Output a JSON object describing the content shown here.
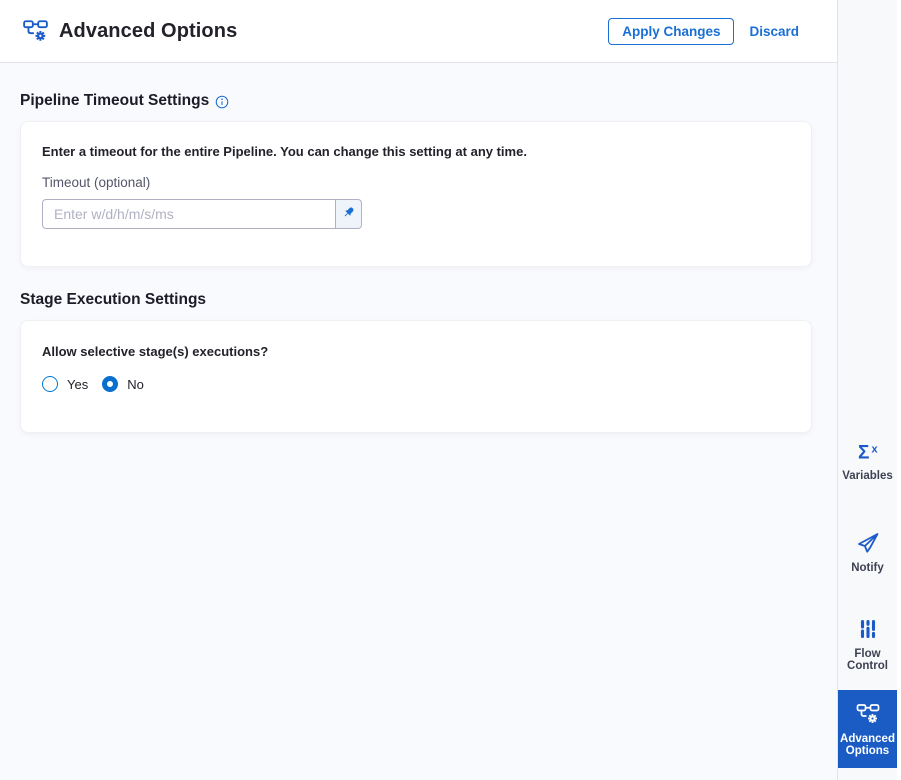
{
  "header": {
    "title": "Advanced Options",
    "apply_label": "Apply Changes",
    "discard_label": "Discard",
    "title_icon": "pipeline-gear-icon"
  },
  "pipeline_timeout": {
    "heading": "Pipeline Timeout Settings",
    "info_icon": "info-icon",
    "description": "Enter a timeout for the entire Pipeline. You can change this setting at any time.",
    "timeout_label": "Timeout (optional)",
    "timeout_placeholder": "Enter w/d/h/m/s/ms",
    "timeout_value": "",
    "pin_icon": "pin-icon"
  },
  "stage_execution": {
    "heading": "Stage Execution Settings",
    "question": "Allow selective stage(s) executions?",
    "options": [
      {
        "label": "Yes",
        "selected": false
      },
      {
        "label": "No",
        "selected": true
      }
    ]
  },
  "sidebar": {
    "items": [
      {
        "label": "Variables",
        "icon": "sigma-x-icon",
        "selected": false
      },
      {
        "label": "Notify",
        "icon": "paper-plane-icon",
        "selected": false
      },
      {
        "label": "Flow Control",
        "icon": "sliders-icon",
        "selected": false
      },
      {
        "label": "Advanced Options",
        "icon": "pipeline-gear-icon",
        "selected": true
      }
    ]
  },
  "colors": {
    "primary_blue": "#1a6fd4",
    "nav_icon_blue": "#1b5bc9",
    "nav_selected_bg": "#1a5cc3",
    "radio_blue": "#0278d5",
    "content_bg": "#f9fafd",
    "sidebar_bg": "#f8f9fa",
    "card_bg": "#ffffff",
    "text_dark": "#22222a",
    "label_gray": "#54566a",
    "placeholder_gray": "#b0b1c4"
  }
}
